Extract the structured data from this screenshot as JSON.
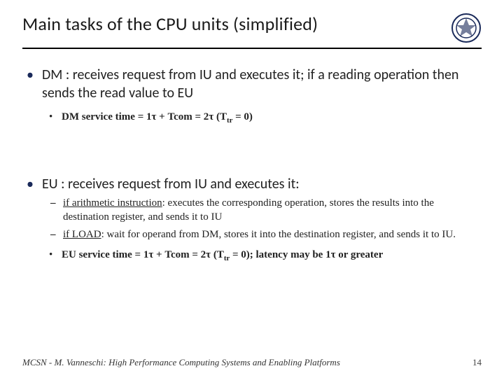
{
  "title": "Main tasks of the CPU units (simplified)",
  "bullets": {
    "dm": {
      "text": "DM : receives request from IU and executes it; if a reading operation then sends the read value to EU",
      "sub": {
        "prefix": "DM service time = 1",
        "mid": " + Tcom = 2",
        "tail_open": " (T",
        "tail_sub": "tr",
        "tail_close": " = 0)"
      }
    },
    "eu": {
      "text": "EU : receives request from IU and executes it:",
      "arith_label": "if arithmetic instruction",
      "arith_rest": ": executes the corresponding operation, stores the results into the destination register, and sends it to IU",
      "load_label": "if LOAD",
      "load_rest": ": wait for operand from DM, stores it into the destination register, and sends it to IU.",
      "svc": {
        "prefix": "EU service time = 1",
        "mid": " + Tcom = 2",
        "tail_open": " (T",
        "tail_sub": "tr",
        "tail_close": " = 0); latency may be 1",
        "post": " or greater"
      }
    }
  },
  "tau": "τ",
  "footer": {
    "left": "MCSN  -   M. Vanneschi: High Performance Computing Systems and Enabling Platforms",
    "page": "14"
  }
}
